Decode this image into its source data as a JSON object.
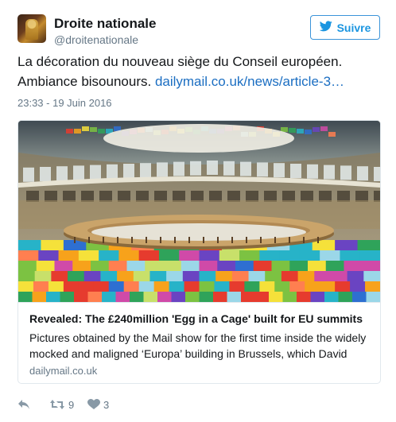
{
  "author": {
    "name": "Droite nationale",
    "handle": "@droitenationale"
  },
  "follow_button": {
    "label": "Suivre",
    "icon": "twitter-bird-icon"
  },
  "tweet": {
    "text_part1": "La décoration du nouveau siège du Conseil européen. Ambiance bisounours. ",
    "link_text": "dailymail.co.uk/news/article-3…",
    "timestamp": "23:33 - 19 Juin 2016"
  },
  "card": {
    "title": "Revealed: The £240million 'Egg in a Cage' built for EU summits",
    "description": "Pictures obtained by the Mail show for the first time inside the widely mocked and maligned ‘Europa’ building in Brussels, which David",
    "domain": "dailymail.co.uk"
  },
  "actions": {
    "reply_icon": "reply-icon",
    "retweet_icon": "retweet-icon",
    "retweet_count": "9",
    "like_icon": "heart-icon",
    "like_count": "3"
  },
  "colors": {
    "link": "#1b6ec2",
    "follow_blue": "#1b95e0",
    "muted": "#657786"
  }
}
